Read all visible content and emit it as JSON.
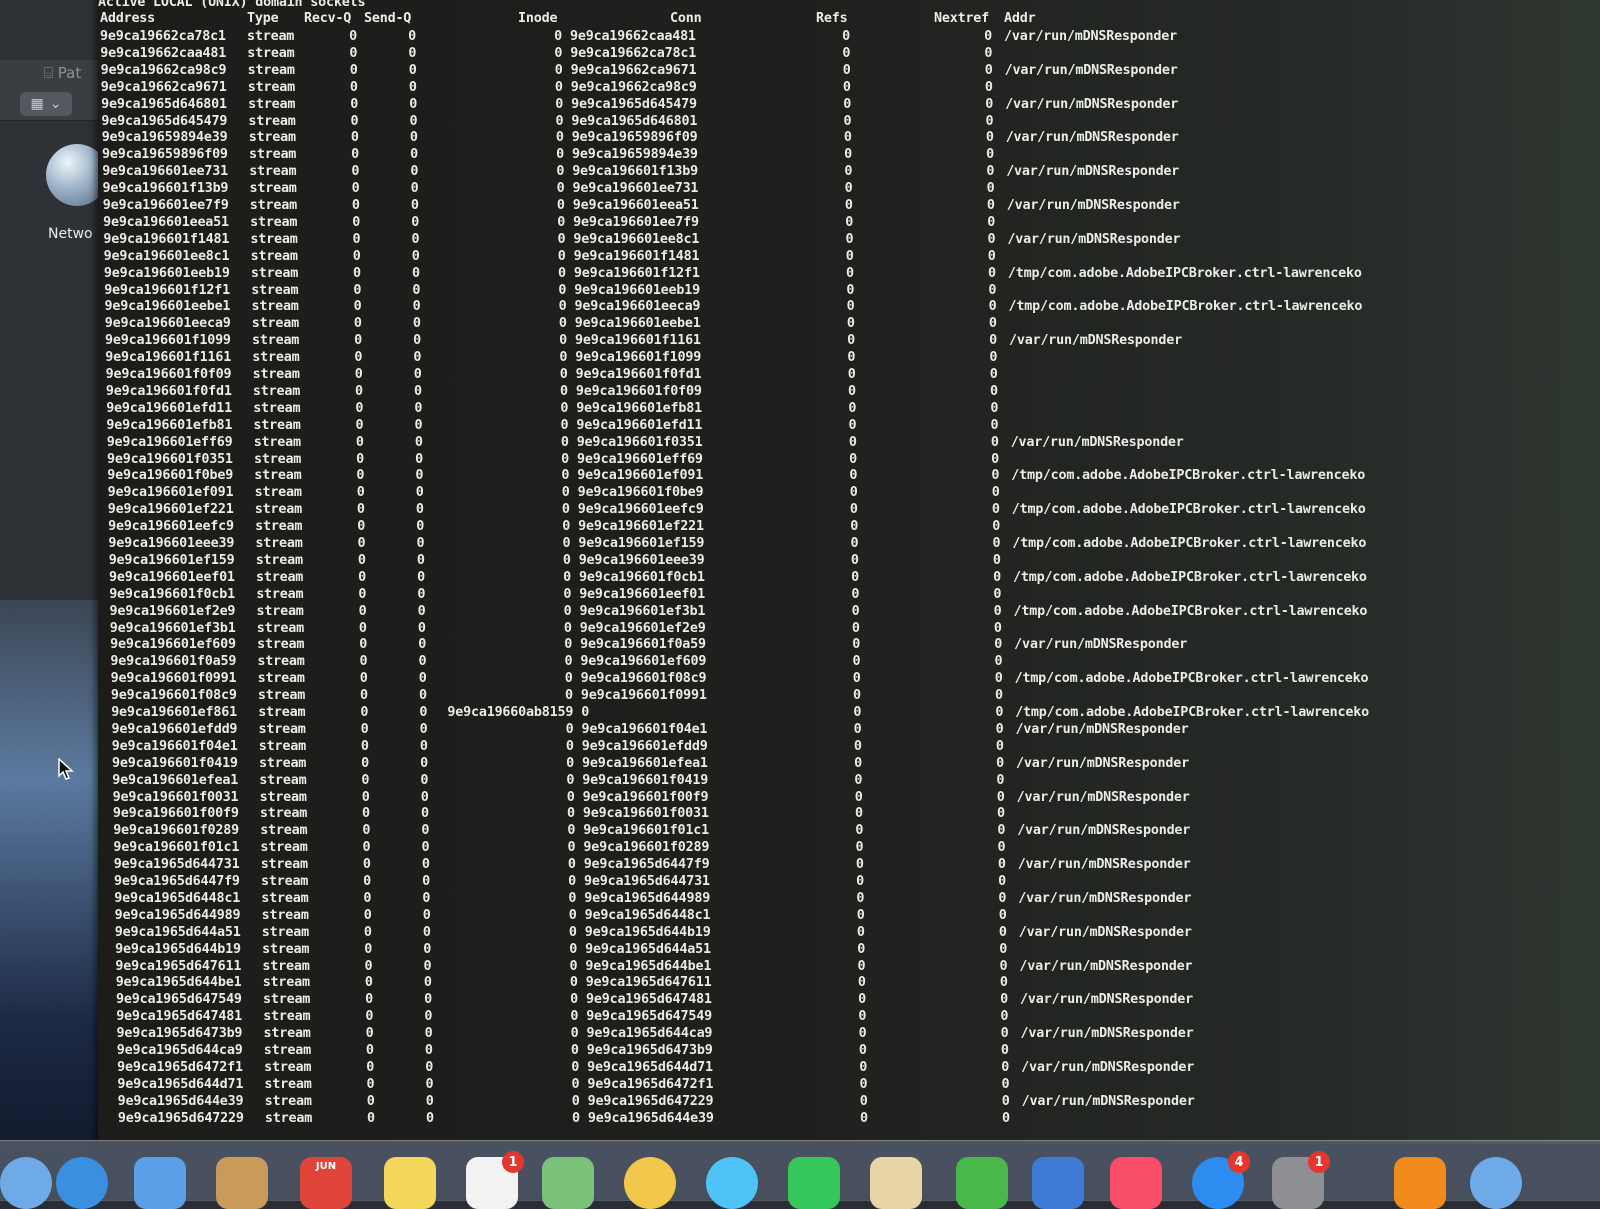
{
  "desktop": {
    "toolbar_label": "Pat",
    "network_label": "Netwo"
  },
  "terminal": {
    "section_title": "Active LOCAL (UNIX) domain sockets",
    "headers": {
      "address": "Address",
      "type": "Type",
      "recvq": "Recv-Q",
      "sendq": "Send-Q",
      "inode": "Inode",
      "conn": "Conn",
      "refs": "Refs",
      "nextref": "Nextref",
      "addr": "Addr"
    },
    "rows": [
      {
        "address": "9e9ca19662ca78c1",
        "type": "stream",
        "recvq": "0",
        "sendq": "0",
        "inode": "0",
        "conn": "9e9ca19662caa481",
        "refs": "0",
        "nextref": "0",
        "addr": "/var/run/mDNSResponder"
      },
      {
        "address": "9e9ca19662caa481",
        "type": "stream",
        "recvq": "0",
        "sendq": "0",
        "inode": "0",
        "conn": "9e9ca19662ca78c1",
        "refs": "0",
        "nextref": "0",
        "addr": ""
      },
      {
        "address": "9e9ca19662ca98c9",
        "type": "stream",
        "recvq": "0",
        "sendq": "0",
        "inode": "0",
        "conn": "9e9ca19662ca9671",
        "refs": "0",
        "nextref": "0",
        "addr": "/var/run/mDNSResponder"
      },
      {
        "address": "9e9ca19662ca9671",
        "type": "stream",
        "recvq": "0",
        "sendq": "0",
        "inode": "0",
        "conn": "9e9ca19662ca98c9",
        "refs": "0",
        "nextref": "0",
        "addr": ""
      },
      {
        "address": "9e9ca1965d646801",
        "type": "stream",
        "recvq": "0",
        "sendq": "0",
        "inode": "0",
        "conn": "9e9ca1965d645479",
        "refs": "0",
        "nextref": "0",
        "addr": "/var/run/mDNSResponder"
      },
      {
        "address": "9e9ca1965d645479",
        "type": "stream",
        "recvq": "0",
        "sendq": "0",
        "inode": "0",
        "conn": "9e9ca1965d646801",
        "refs": "0",
        "nextref": "0",
        "addr": ""
      },
      {
        "address": "9e9ca19659894e39",
        "type": "stream",
        "recvq": "0",
        "sendq": "0",
        "inode": "0",
        "conn": "9e9ca19659896f09",
        "refs": "0",
        "nextref": "0",
        "addr": "/var/run/mDNSResponder"
      },
      {
        "address": "9e9ca19659896f09",
        "type": "stream",
        "recvq": "0",
        "sendq": "0",
        "inode": "0",
        "conn": "9e9ca19659894e39",
        "refs": "0",
        "nextref": "0",
        "addr": ""
      },
      {
        "address": "9e9ca196601ee731",
        "type": "stream",
        "recvq": "0",
        "sendq": "0",
        "inode": "0",
        "conn": "9e9ca196601f13b9",
        "refs": "0",
        "nextref": "0",
        "addr": "/var/run/mDNSResponder"
      },
      {
        "address": "9e9ca196601f13b9",
        "type": "stream",
        "recvq": "0",
        "sendq": "0",
        "inode": "0",
        "conn": "9e9ca196601ee731",
        "refs": "0",
        "nextref": "0",
        "addr": ""
      },
      {
        "address": "9e9ca196601ee7f9",
        "type": "stream",
        "recvq": "0",
        "sendq": "0",
        "inode": "0",
        "conn": "9e9ca196601eea51",
        "refs": "0",
        "nextref": "0",
        "addr": "/var/run/mDNSResponder"
      },
      {
        "address": "9e9ca196601eea51",
        "type": "stream",
        "recvq": "0",
        "sendq": "0",
        "inode": "0",
        "conn": "9e9ca196601ee7f9",
        "refs": "0",
        "nextref": "0",
        "addr": ""
      },
      {
        "address": "9e9ca196601f1481",
        "type": "stream",
        "recvq": "0",
        "sendq": "0",
        "inode": "0",
        "conn": "9e9ca196601ee8c1",
        "refs": "0",
        "nextref": "0",
        "addr": "/var/run/mDNSResponder"
      },
      {
        "address": "9e9ca196601ee8c1",
        "type": "stream",
        "recvq": "0",
        "sendq": "0",
        "inode": "0",
        "conn": "9e9ca196601f1481",
        "refs": "0",
        "nextref": "0",
        "addr": ""
      },
      {
        "address": "9e9ca196601eeb19",
        "type": "stream",
        "recvq": "0",
        "sendq": "0",
        "inode": "0",
        "conn": "9e9ca196601f12f1",
        "refs": "0",
        "nextref": "0",
        "addr": "/tmp/com.adobe.AdobeIPCBroker.ctrl-lawrenceko"
      },
      {
        "address": "9e9ca196601f12f1",
        "type": "stream",
        "recvq": "0",
        "sendq": "0",
        "inode": "0",
        "conn": "9e9ca196601eeb19",
        "refs": "0",
        "nextref": "0",
        "addr": ""
      },
      {
        "address": "9e9ca196601eebe1",
        "type": "stream",
        "recvq": "0",
        "sendq": "0",
        "inode": "0",
        "conn": "9e9ca196601eeca9",
        "refs": "0",
        "nextref": "0",
        "addr": "/tmp/com.adobe.AdobeIPCBroker.ctrl-lawrenceko"
      },
      {
        "address": "9e9ca196601eeca9",
        "type": "stream",
        "recvq": "0",
        "sendq": "0",
        "inode": "0",
        "conn": "9e9ca196601eebe1",
        "refs": "0",
        "nextref": "0",
        "addr": ""
      },
      {
        "address": "9e9ca196601f1099",
        "type": "stream",
        "recvq": "0",
        "sendq": "0",
        "inode": "0",
        "conn": "9e9ca196601f1161",
        "refs": "0",
        "nextref": "0",
        "addr": "/var/run/mDNSResponder"
      },
      {
        "address": "9e9ca196601f1161",
        "type": "stream",
        "recvq": "0",
        "sendq": "0",
        "inode": "0",
        "conn": "9e9ca196601f1099",
        "refs": "0",
        "nextref": "0",
        "addr": ""
      },
      {
        "address": "9e9ca196601f0f09",
        "type": "stream",
        "recvq": "0",
        "sendq": "0",
        "inode": "0",
        "conn": "9e9ca196601f0fd1",
        "refs": "0",
        "nextref": "0",
        "addr": ""
      },
      {
        "address": "9e9ca196601f0fd1",
        "type": "stream",
        "recvq": "0",
        "sendq": "0",
        "inode": "0",
        "conn": "9e9ca196601f0f09",
        "refs": "0",
        "nextref": "0",
        "addr": ""
      },
      {
        "address": "9e9ca196601efd11",
        "type": "stream",
        "recvq": "0",
        "sendq": "0",
        "inode": "0",
        "conn": "9e9ca196601efb81",
        "refs": "0",
        "nextref": "0",
        "addr": ""
      },
      {
        "address": "9e9ca196601efb81",
        "type": "stream",
        "recvq": "0",
        "sendq": "0",
        "inode": "0",
        "conn": "9e9ca196601efd11",
        "refs": "0",
        "nextref": "0",
        "addr": ""
      },
      {
        "address": "9e9ca196601eff69",
        "type": "stream",
        "recvq": "0",
        "sendq": "0",
        "inode": "0",
        "conn": "9e9ca196601f0351",
        "refs": "0",
        "nextref": "0",
        "addr": "/var/run/mDNSResponder"
      },
      {
        "address": "9e9ca196601f0351",
        "type": "stream",
        "recvq": "0",
        "sendq": "0",
        "inode": "0",
        "conn": "9e9ca196601eff69",
        "refs": "0",
        "nextref": "0",
        "addr": ""
      },
      {
        "address": "9e9ca196601f0be9",
        "type": "stream",
        "recvq": "0",
        "sendq": "0",
        "inode": "0",
        "conn": "9e9ca196601ef091",
        "refs": "0",
        "nextref": "0",
        "addr": "/tmp/com.adobe.AdobeIPCBroker.ctrl-lawrenceko"
      },
      {
        "address": "9e9ca196601ef091",
        "type": "stream",
        "recvq": "0",
        "sendq": "0",
        "inode": "0",
        "conn": "9e9ca196601f0be9",
        "refs": "0",
        "nextref": "0",
        "addr": ""
      },
      {
        "address": "9e9ca196601ef221",
        "type": "stream",
        "recvq": "0",
        "sendq": "0",
        "inode": "0",
        "conn": "9e9ca196601eefc9",
        "refs": "0",
        "nextref": "0",
        "addr": "/tmp/com.adobe.AdobeIPCBroker.ctrl-lawrenceko"
      },
      {
        "address": "9e9ca196601eefc9",
        "type": "stream",
        "recvq": "0",
        "sendq": "0",
        "inode": "0",
        "conn": "9e9ca196601ef221",
        "refs": "0",
        "nextref": "0",
        "addr": ""
      },
      {
        "address": "9e9ca196601eee39",
        "type": "stream",
        "recvq": "0",
        "sendq": "0",
        "inode": "0",
        "conn": "9e9ca196601ef159",
        "refs": "0",
        "nextref": "0",
        "addr": "/tmp/com.adobe.AdobeIPCBroker.ctrl-lawrenceko"
      },
      {
        "address": "9e9ca196601ef159",
        "type": "stream",
        "recvq": "0",
        "sendq": "0",
        "inode": "0",
        "conn": "9e9ca196601eee39",
        "refs": "0",
        "nextref": "0",
        "addr": ""
      },
      {
        "address": "9e9ca196601eef01",
        "type": "stream",
        "recvq": "0",
        "sendq": "0",
        "inode": "0",
        "conn": "9e9ca196601f0cb1",
        "refs": "0",
        "nextref": "0",
        "addr": "/tmp/com.adobe.AdobeIPCBroker.ctrl-lawrenceko"
      },
      {
        "address": "9e9ca196601f0cb1",
        "type": "stream",
        "recvq": "0",
        "sendq": "0",
        "inode": "0",
        "conn": "9e9ca196601eef01",
        "refs": "0",
        "nextref": "0",
        "addr": ""
      },
      {
        "address": "9e9ca196601ef2e9",
        "type": "stream",
        "recvq": "0",
        "sendq": "0",
        "inode": "0",
        "conn": "9e9ca196601ef3b1",
        "refs": "0",
        "nextref": "0",
        "addr": "/tmp/com.adobe.AdobeIPCBroker.ctrl-lawrenceko"
      },
      {
        "address": "9e9ca196601ef3b1",
        "type": "stream",
        "recvq": "0",
        "sendq": "0",
        "inode": "0",
        "conn": "9e9ca196601ef2e9",
        "refs": "0",
        "nextref": "0",
        "addr": ""
      },
      {
        "address": "9e9ca196601ef609",
        "type": "stream",
        "recvq": "0",
        "sendq": "0",
        "inode": "0",
        "conn": "9e9ca196601f0a59",
        "refs": "0",
        "nextref": "0",
        "addr": "/var/run/mDNSResponder"
      },
      {
        "address": "9e9ca196601f0a59",
        "type": "stream",
        "recvq": "0",
        "sendq": "0",
        "inode": "0",
        "conn": "9e9ca196601ef609",
        "refs": "0",
        "nextref": "0",
        "addr": ""
      },
      {
        "address": "9e9ca196601f0991",
        "type": "stream",
        "recvq": "0",
        "sendq": "0",
        "inode": "0",
        "conn": "9e9ca196601f08c9",
        "refs": "0",
        "nextref": "0",
        "addr": "/tmp/com.adobe.AdobeIPCBroker.ctrl-lawrenceko"
      },
      {
        "address": "9e9ca196601f08c9",
        "type": "stream",
        "recvq": "0",
        "sendq": "0",
        "inode": "0",
        "conn": "9e9ca196601f0991",
        "refs": "0",
        "nextref": "0",
        "addr": ""
      },
      {
        "address": "9e9ca196601ef861",
        "type": "stream",
        "recvq": "0",
        "sendq": "0",
        "inode": "9e9ca19660ab8159",
        "conn": "0",
        "refs": "0",
        "nextref": "0",
        "addr": "/tmp/com.adobe.AdobeIPCBroker.ctrl-lawrenceko"
      },
      {
        "address": "9e9ca196601efdd9",
        "type": "stream",
        "recvq": "0",
        "sendq": "0",
        "inode": "0",
        "conn": "9e9ca196601f04e1",
        "refs": "0",
        "nextref": "0",
        "addr": "/var/run/mDNSResponder"
      },
      {
        "address": "9e9ca196601f04e1",
        "type": "stream",
        "recvq": "0",
        "sendq": "0",
        "inode": "0",
        "conn": "9e9ca196601efdd9",
        "refs": "0",
        "nextref": "0",
        "addr": ""
      },
      {
        "address": "9e9ca196601f0419",
        "type": "stream",
        "recvq": "0",
        "sendq": "0",
        "inode": "0",
        "conn": "9e9ca196601efea1",
        "refs": "0",
        "nextref": "0",
        "addr": "/var/run/mDNSResponder"
      },
      {
        "address": "9e9ca196601efea1",
        "type": "stream",
        "recvq": "0",
        "sendq": "0",
        "inode": "0",
        "conn": "9e9ca196601f0419",
        "refs": "0",
        "nextref": "0",
        "addr": ""
      },
      {
        "address": "9e9ca196601f0031",
        "type": "stream",
        "recvq": "0",
        "sendq": "0",
        "inode": "0",
        "conn": "9e9ca196601f00f9",
        "refs": "0",
        "nextref": "0",
        "addr": "/var/run/mDNSResponder"
      },
      {
        "address": "9e9ca196601f00f9",
        "type": "stream",
        "recvq": "0",
        "sendq": "0",
        "inode": "0",
        "conn": "9e9ca196601f0031",
        "refs": "0",
        "nextref": "0",
        "addr": ""
      },
      {
        "address": "9e9ca196601f0289",
        "type": "stream",
        "recvq": "0",
        "sendq": "0",
        "inode": "0",
        "conn": "9e9ca196601f01c1",
        "refs": "0",
        "nextref": "0",
        "addr": "/var/run/mDNSResponder"
      },
      {
        "address": "9e9ca196601f01c1",
        "type": "stream",
        "recvq": "0",
        "sendq": "0",
        "inode": "0",
        "conn": "9e9ca196601f0289",
        "refs": "0",
        "nextref": "0",
        "addr": ""
      },
      {
        "address": "9e9ca1965d644731",
        "type": "stream",
        "recvq": "0",
        "sendq": "0",
        "inode": "0",
        "conn": "9e9ca1965d6447f9",
        "refs": "0",
        "nextref": "0",
        "addr": "/var/run/mDNSResponder"
      },
      {
        "address": "9e9ca1965d6447f9",
        "type": "stream",
        "recvq": "0",
        "sendq": "0",
        "inode": "0",
        "conn": "9e9ca1965d644731",
        "refs": "0",
        "nextref": "0",
        "addr": ""
      },
      {
        "address": "9e9ca1965d6448c1",
        "type": "stream",
        "recvq": "0",
        "sendq": "0",
        "inode": "0",
        "conn": "9e9ca1965d644989",
        "refs": "0",
        "nextref": "0",
        "addr": "/var/run/mDNSResponder"
      },
      {
        "address": "9e9ca1965d644989",
        "type": "stream",
        "recvq": "0",
        "sendq": "0",
        "inode": "0",
        "conn": "9e9ca1965d6448c1",
        "refs": "0",
        "nextref": "0",
        "addr": ""
      },
      {
        "address": "9e9ca1965d644a51",
        "type": "stream",
        "recvq": "0",
        "sendq": "0",
        "inode": "0",
        "conn": "9e9ca1965d644b19",
        "refs": "0",
        "nextref": "0",
        "addr": "/var/run/mDNSResponder"
      },
      {
        "address": "9e9ca1965d644b19",
        "type": "stream",
        "recvq": "0",
        "sendq": "0",
        "inode": "0",
        "conn": "9e9ca1965d644a51",
        "refs": "0",
        "nextref": "0",
        "addr": ""
      },
      {
        "address": "9e9ca1965d647611",
        "type": "stream",
        "recvq": "0",
        "sendq": "0",
        "inode": "0",
        "conn": "9e9ca1965d644be1",
        "refs": "0",
        "nextref": "0",
        "addr": "/var/run/mDNSResponder"
      },
      {
        "address": "9e9ca1965d644be1",
        "type": "stream",
        "recvq": "0",
        "sendq": "0",
        "inode": "0",
        "conn": "9e9ca1965d647611",
        "refs": "0",
        "nextref": "0",
        "addr": ""
      },
      {
        "address": "9e9ca1965d647549",
        "type": "stream",
        "recvq": "0",
        "sendq": "0",
        "inode": "0",
        "conn": "9e9ca1965d647481",
        "refs": "0",
        "nextref": "0",
        "addr": "/var/run/mDNSResponder"
      },
      {
        "address": "9e9ca1965d647481",
        "type": "stream",
        "recvq": "0",
        "sendq": "0",
        "inode": "0",
        "conn": "9e9ca1965d647549",
        "refs": "0",
        "nextref": "0",
        "addr": ""
      },
      {
        "address": "9e9ca1965d6473b9",
        "type": "stream",
        "recvq": "0",
        "sendq": "0",
        "inode": "0",
        "conn": "9e9ca1965d644ca9",
        "refs": "0",
        "nextref": "0",
        "addr": "/var/run/mDNSResponder"
      },
      {
        "address": "9e9ca1965d644ca9",
        "type": "stream",
        "recvq": "0",
        "sendq": "0",
        "inode": "0",
        "conn": "9e9ca1965d6473b9",
        "refs": "0",
        "nextref": "0",
        "addr": ""
      },
      {
        "address": "9e9ca1965d6472f1",
        "type": "stream",
        "recvq": "0",
        "sendq": "0",
        "inode": "0",
        "conn": "9e9ca1965d644d71",
        "refs": "0",
        "nextref": "0",
        "addr": "/var/run/mDNSResponder"
      },
      {
        "address": "9e9ca1965d644d71",
        "type": "stream",
        "recvq": "0",
        "sendq": "0",
        "inode": "0",
        "conn": "9e9ca1965d6472f1",
        "refs": "0",
        "nextref": "0",
        "addr": ""
      },
      {
        "address": "9e9ca1965d644e39",
        "type": "stream",
        "recvq": "0",
        "sendq": "0",
        "inode": "0",
        "conn": "9e9ca1965d647229",
        "refs": "0",
        "nextref": "0",
        "addr": "/var/run/mDNSResponder"
      },
      {
        "address": "9e9ca1965d647229",
        "type": "stream",
        "recvq": "0",
        "sendq": "0",
        "inode": "0",
        "conn": "9e9ca1965d644e39",
        "refs": "0",
        "nextref": "0",
        "addr": ""
      }
    ]
  },
  "dock": {
    "calendar_month": "JUN",
    "badges": {
      "mail": "1",
      "appstore": "4",
      "settings": "1"
    },
    "colors": {
      "safari": "#3b8fe0",
      "mail": "#5aa0e6",
      "contacts": "#c99a5a",
      "calendar": "#e0453a",
      "notes": "#f4d65a",
      "reminders": "#f2f2f2",
      "maps": "#7ac27a",
      "photos": "#f1c84b",
      "messages": "#4fc3f7",
      "facetime": "#35c759",
      "preview": "#e9d5a6",
      "numbers": "#48b84a",
      "keynote": "#3d7bd6",
      "music": "#fa4d6a",
      "appstore": "#2d8cf0",
      "settings": "#8e8e93",
      "vlc": "#f08a1c",
      "finder": "#6ea9e8"
    }
  }
}
